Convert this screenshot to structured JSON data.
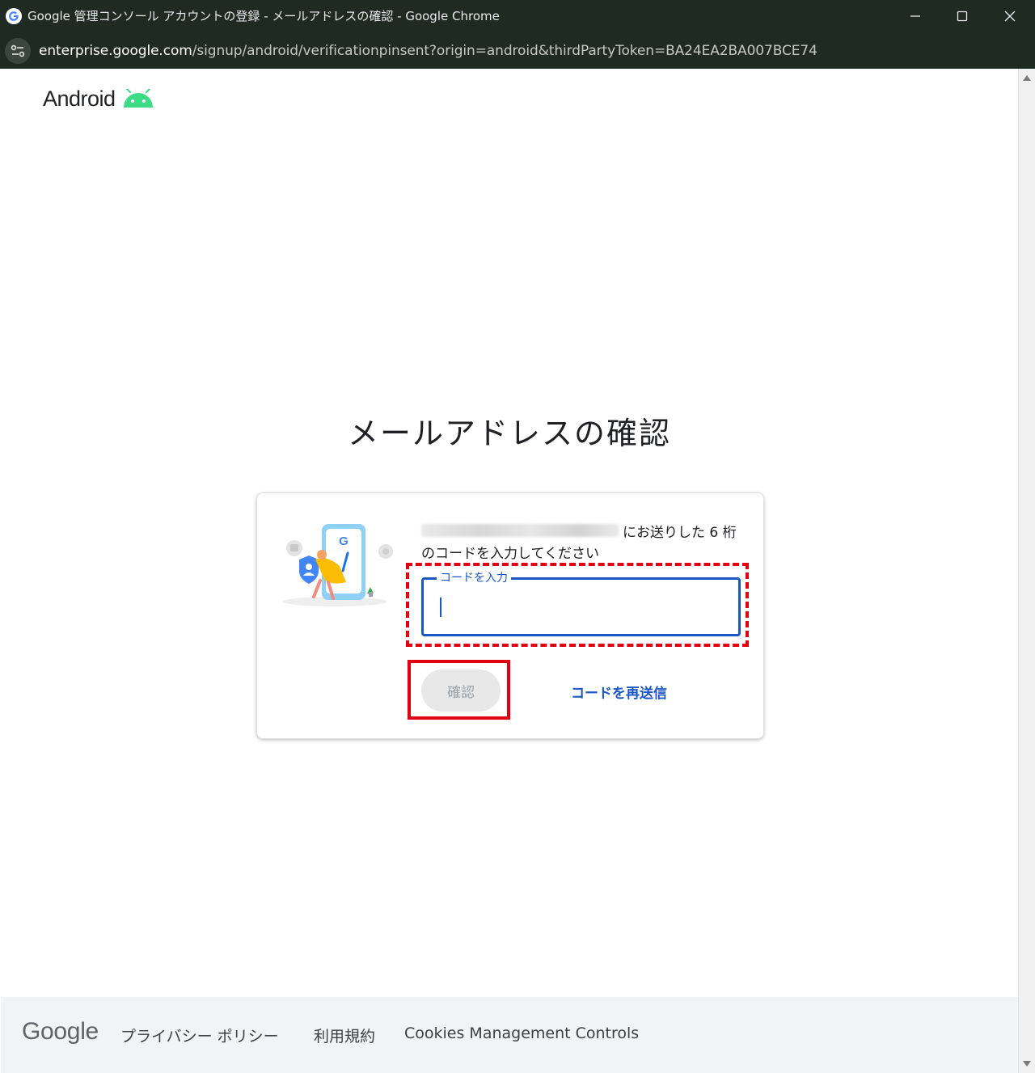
{
  "window": {
    "title": "Google 管理コンソール アカウントの登録 - メールアドレスの確認 - Google Chrome",
    "minimize_icon": "minimize-icon",
    "maximize_icon": "maximize-icon",
    "close_icon": "close-icon"
  },
  "address_bar": {
    "host": "enterprise.google.com",
    "path": "/signup/android/verificationpinsent?origin=android&thirdPartyToken=BA24EA2BA007BCE74"
  },
  "brand": {
    "name": "Android",
    "robot_color": "#3ddc84"
  },
  "heading": "メールアドレスの確認",
  "card": {
    "instruction_line1": "にお送りした 6 桁",
    "instruction_line2": "のコードを入力してください",
    "code_field_label": "コードを入力",
    "code_value": "",
    "confirm_label": "確認",
    "resend_label": "コードを再送信"
  },
  "footer": {
    "logo": "Google",
    "links": [
      "プライバシー ポリシー",
      "利用規約",
      "Cookies Management Controls"
    ]
  },
  "colors": {
    "accent": "#1a56c4",
    "annotation": "#e00012",
    "title_bar": "#1e2a22"
  }
}
